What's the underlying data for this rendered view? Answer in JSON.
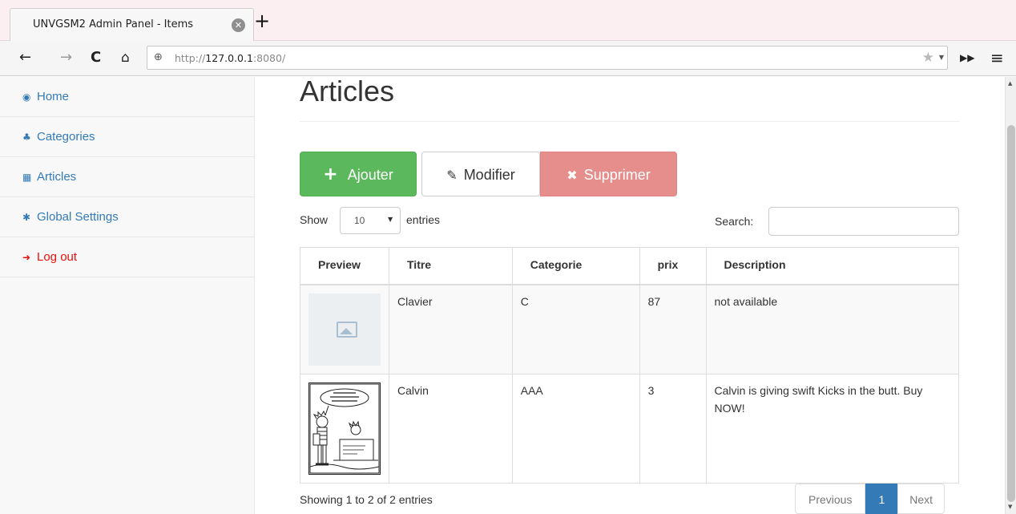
{
  "browser": {
    "tab_title": "UNVGSM2 Admin Panel - Items",
    "url_prefix": "http://",
    "url_host": "127.0.0.1",
    "url_suffix": ":8080/"
  },
  "sidebar": {
    "items": [
      {
        "label": "Home",
        "icon": "dashboard-icon"
      },
      {
        "label": "Categories",
        "icon": "sitemap-icon"
      },
      {
        "label": "Articles",
        "icon": "table-icon"
      },
      {
        "label": "Global Settings",
        "icon": "gear-icon"
      },
      {
        "label": "Log out",
        "icon": "sign-out-icon"
      }
    ]
  },
  "main": {
    "title": "Articles",
    "buttons": {
      "add": "Ajouter",
      "edit": "Modifier",
      "delete": "Supprimer"
    },
    "length": {
      "show": "Show",
      "value": "10",
      "entries": "entries"
    },
    "search": {
      "label": "Search:",
      "value": ""
    },
    "table": {
      "headers": [
        "Preview",
        "Titre",
        "Categorie",
        "prix",
        "Description"
      ],
      "rows": [
        {
          "preview": "image-placeholder-icon",
          "titre": "Clavier",
          "categorie": "C",
          "prix": "87",
          "description": "not available"
        },
        {
          "preview": "calvin-comic-image",
          "titre": "Calvin",
          "categorie": "AAA",
          "prix": "3",
          "description": "Calvin is giving swift Kicks in the butt. Buy NOW!"
        }
      ]
    },
    "info": "Showing 1 to 2 of 2 entries",
    "pagination": {
      "previous": "Previous",
      "current": "1",
      "next": "Next"
    }
  },
  "colors": {
    "link": "#337ab7",
    "success": "#5cb85c",
    "danger_disabled": "#e58e8c",
    "logout": "#e8100a"
  }
}
